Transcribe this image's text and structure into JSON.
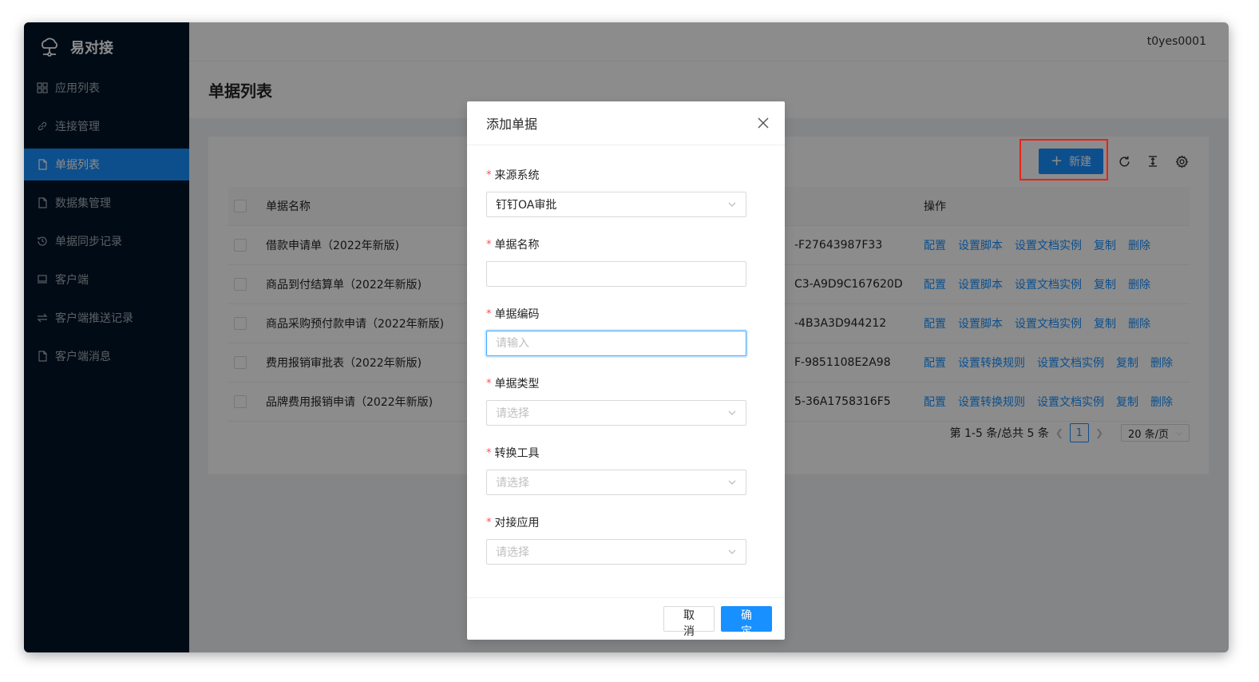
{
  "brand": {
    "name": "易对接"
  },
  "sidebar": {
    "items": [
      {
        "label": "应用列表",
        "icon": "grid-icon"
      },
      {
        "label": "连接管理",
        "icon": "link-icon"
      },
      {
        "label": "单据列表",
        "icon": "file-icon",
        "active": true
      },
      {
        "label": "数据集管理",
        "icon": "file-icon"
      },
      {
        "label": "单据同步记录",
        "icon": "history-icon"
      },
      {
        "label": "客户端",
        "icon": "laptop-icon"
      },
      {
        "label": "客户端推送记录",
        "icon": "swap-icon"
      },
      {
        "label": "客户端消息",
        "icon": "file-icon"
      }
    ]
  },
  "topbar": {
    "username": "t0yes0001"
  },
  "page": {
    "title": "单据列表"
  },
  "toolbar": {
    "new_label": "新建"
  },
  "table": {
    "headers": {
      "name": "单据名称",
      "actions": "操作"
    },
    "rows": [
      {
        "name": "借款申请单（2022年新版)",
        "code": "-F27643987F33",
        "actions": [
          "配置",
          "设置脚本",
          "设置文档实例",
          "复制",
          "删除"
        ]
      },
      {
        "name": "商品到付结算单（2022年新版)",
        "code": "C3-A9D9C167620D",
        "actions": [
          "配置",
          "设置脚本",
          "设置文档实例",
          "复制",
          "删除"
        ]
      },
      {
        "name": "商品采购预付款申请（2022年新版)",
        "code": "-4B3A3D944212",
        "actions": [
          "配置",
          "设置脚本",
          "设置文档实例",
          "复制",
          "删除"
        ]
      },
      {
        "name": "费用报销审批表（2022年新版)",
        "code": "F-9851108E2A98",
        "actions": [
          "配置",
          "设置转换规则",
          "设置文档实例",
          "复制",
          "删除"
        ]
      },
      {
        "name": "品牌费用报销申请（2022年新版)",
        "code": "5-36A1758316F5",
        "actions": [
          "配置",
          "设置转换规则",
          "设置文档实例",
          "复制",
          "删除"
        ]
      }
    ]
  },
  "pagination": {
    "summary": "第 1-5 条/总共 5 条",
    "current": "1",
    "page_size": "20 条/页"
  },
  "modal": {
    "title": "添加单据",
    "fields": {
      "source": {
        "label": "来源系统",
        "value": "钉钉OA审批"
      },
      "name": {
        "label": "单据名称",
        "value": ""
      },
      "code": {
        "label": "单据编码",
        "placeholder": "请输入"
      },
      "type": {
        "label": "单据类型",
        "placeholder": "请选择"
      },
      "tool": {
        "label": "转换工具",
        "placeholder": "请选择"
      },
      "app": {
        "label": "对接应用",
        "placeholder": "请选择"
      }
    },
    "cancel_label": "取 消",
    "ok_label": "确 定"
  },
  "colors": {
    "primary": "#1890ff",
    "sidebar_bg": "#001529",
    "highlight": "#e8221a"
  }
}
